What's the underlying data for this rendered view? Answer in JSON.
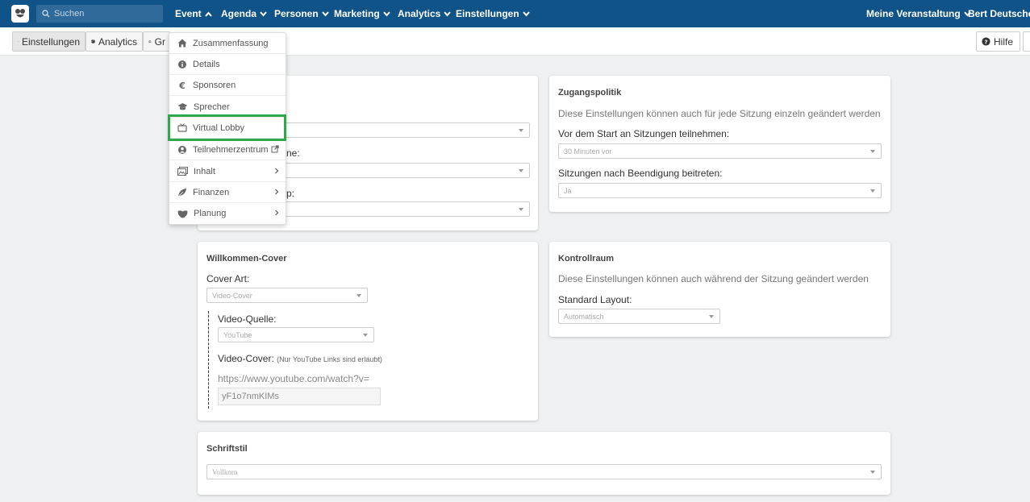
{
  "nav": {
    "search_placeholder": "Suchen",
    "items": [
      "Event",
      "Agenda",
      "Personen",
      "Marketing",
      "Analytics",
      "Einstellungen"
    ],
    "right_items": [
      "Meine Veranstaltung",
      "Bert Deutscher"
    ],
    "color": "#0f5389"
  },
  "toolbar": {
    "buttons": [
      "Einstellungen",
      "Analytics",
      "Gr"
    ],
    "help": "Hilfe"
  },
  "menu": {
    "items": [
      {
        "label": "Zusammenfassung",
        "icon": "home-icon"
      },
      {
        "label": "Details",
        "icon": "info-icon"
      },
      {
        "label": "Sponsoren",
        "icon": "euro-icon"
      },
      {
        "label": "Sprecher",
        "icon": "graduation-cap-icon"
      },
      {
        "label": "Virtual Lobby",
        "icon": "tv-icon"
      },
      {
        "label": "Teilnehmerzentrum",
        "icon": "user-circle-icon"
      },
      {
        "label": "Inhalt",
        "icon": "image-icon"
      },
      {
        "label": "Finanzen",
        "icon": "leaf-icon"
      },
      {
        "label": "Planung",
        "icon": "handshake-icon"
      }
    ],
    "highlight_color": "#2ea84a"
  },
  "card1": {
    "label_partial_1": "ne:",
    "label_partial_2": "p:"
  },
  "zugang": {
    "title": "Zugangspolitik",
    "desc": "Diese Einstellungen können auch für jede Sitzung einzeln geändert werden",
    "label1": "Vor dem Start an Sitzungen teilnehmen:",
    "value1": "30 Minuten vor",
    "label2": "Sitzungen nach Beendigung beitreten:",
    "value2": "Ja"
  },
  "cover": {
    "title": "Willkommen-Cover",
    "art_label": "Cover Art:",
    "art_value": "Video-Cover",
    "source_label": "Video-Quelle:",
    "source_value": "YouTube",
    "video_label": "Video-Cover:",
    "video_hint": "(Nur YouTube Links sind erlaubt)",
    "url_line1": "https://www.youtube.com/watch?v=",
    "url_line2": "yF1o7nmKIMs"
  },
  "kontroll": {
    "title": "Kontrollraum",
    "desc": "Diese Einstellungen können auch während der Sitzung geändert werden",
    "label": "Standard Layout:",
    "value": "Automatisch"
  },
  "schrift": {
    "title": "Schriftstil",
    "value": "Vollkorn"
  }
}
